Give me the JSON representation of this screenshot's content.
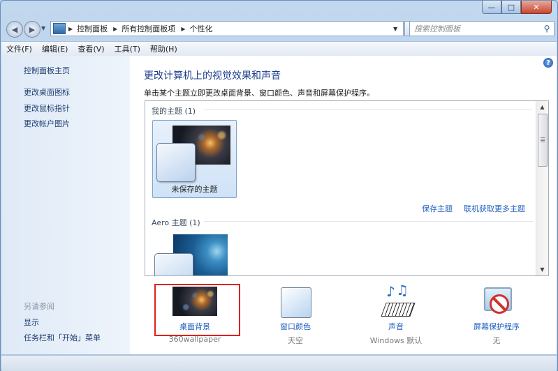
{
  "window": {
    "controls": {
      "minimize": "—",
      "maximize": "□",
      "close": "✕"
    }
  },
  "nav": {
    "back_icon": "back-arrow-icon",
    "forward_icon": "forward-arrow-icon",
    "breadcrumbs": [
      "控制面板",
      "所有控制面板项",
      "个性化"
    ],
    "search_placeholder": "搜索控制面板"
  },
  "menu": [
    "文件(F)",
    "编辑(E)",
    "查看(V)",
    "工具(T)",
    "帮助(H)"
  ],
  "sidebar": {
    "home": "控制面板主页",
    "links": [
      "更改桌面图标",
      "更改鼠标指针",
      "更改帐户图片"
    ],
    "see_also_title": "另请参阅",
    "see_also": [
      "显示",
      "任务栏和「开始」菜单"
    ]
  },
  "main": {
    "help_icon": "?",
    "title": "更改计算机上的视觉效果和声音",
    "description": "单击某个主题立即更改桌面背景、窗口颜色、声音和屏幕保护程序。",
    "my_themes_header": "我的主题 (1)",
    "unsaved_theme": "未保存的主题",
    "save_theme": "保存主题",
    "get_more_themes": "联机获取更多主题",
    "aero_header": "Aero 主题 (1)"
  },
  "settings": [
    {
      "label": "桌面背景",
      "value": "360wallpaper",
      "icon": "desktop-background-icon"
    },
    {
      "label": "窗口颜色",
      "value": "天空",
      "icon": "window-color-icon"
    },
    {
      "label": "声音",
      "value": "Windows 默认",
      "icon": "sounds-icon"
    },
    {
      "label": "屏幕保护程序",
      "value": "无",
      "icon": "screensaver-icon"
    }
  ],
  "colors": {
    "accent": "#1f5fbf",
    "title": "#1d3c8b",
    "highlight": "#e0201b"
  }
}
